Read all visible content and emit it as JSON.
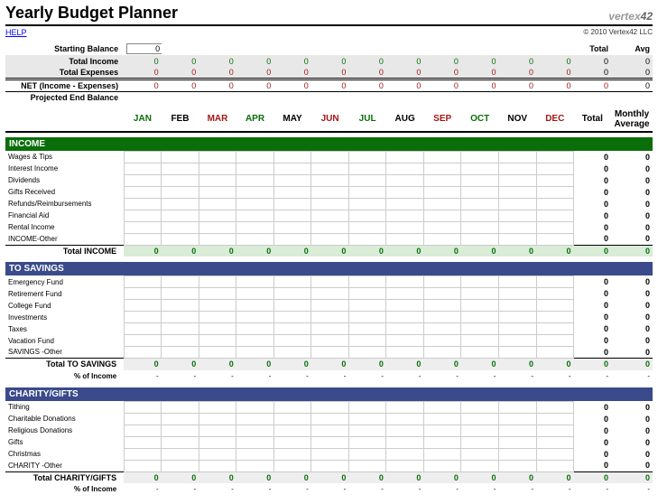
{
  "title": "Yearly Budget Planner",
  "logo_prefix": "vertex",
  "logo_suffix": "42",
  "help": "HELP",
  "copyright": "© 2010 Vertex42 LLC",
  "months": [
    "JAN",
    "FEB",
    "MAR",
    "APR",
    "MAY",
    "JUN",
    "JUL",
    "AUG",
    "SEP",
    "OCT",
    "NOV",
    "DEC"
  ],
  "month_colors": [
    "m-green",
    "m-black",
    "m-red",
    "m-green",
    "m-black",
    "m-red",
    "m-green",
    "m-black",
    "m-red",
    "m-green",
    "m-black",
    "m-red"
  ],
  "summaryHeaders": {
    "total": "Total",
    "avg": "Avg",
    "monthlyAvg": "Monthly\nAverage"
  },
  "summary": {
    "starting": {
      "label": "Starting Balance",
      "value": "0"
    },
    "income": {
      "label": "Total Income",
      "vals": [
        0,
        0,
        0,
        0,
        0,
        0,
        0,
        0,
        0,
        0,
        0,
        0
      ],
      "total": 0,
      "avg": 0
    },
    "expenses": {
      "label": "Total Expenses",
      "vals": [
        0,
        0,
        0,
        0,
        0,
        0,
        0,
        0,
        0,
        0,
        0,
        0
      ],
      "total": 0,
      "avg": 0
    },
    "net": {
      "label": "NET (Income - Expenses)",
      "vals": [
        0,
        0,
        0,
        0,
        0,
        0,
        0,
        0,
        0,
        0,
        0,
        0
      ],
      "total": 0,
      "avg": 0
    },
    "projected": {
      "label": "Projected End Balance"
    }
  },
  "sections": [
    {
      "name": "INCOME",
      "color": "sec-green",
      "rows": [
        "Wages & Tips",
        "Interest Income",
        "Dividends",
        "Gifts Received",
        "Refunds/Reimbursements",
        "Financial Aid",
        "Rental Income",
        "INCOME-Other"
      ],
      "subtotalLabel": "Total INCOME",
      "subtotalClass": "lightgreen",
      "subtotal": {
        "vals": [
          0,
          0,
          0,
          0,
          0,
          0,
          0,
          0,
          0,
          0,
          0,
          0
        ],
        "total": 0,
        "avg": 0
      },
      "pct": null
    },
    {
      "name": "TO SAVINGS",
      "color": "sec-blue",
      "rows": [
        "Emergency Fund",
        "Retirement Fund",
        "College Fund",
        "Investments",
        "Taxes",
        "Vacation Fund",
        "SAVINGS -Other"
      ],
      "subtotalLabel": "Total TO SAVINGS",
      "subtotalClass": "lightgray",
      "subtotal": {
        "vals": [
          0,
          0,
          0,
          0,
          0,
          0,
          0,
          0,
          0,
          0,
          0,
          0
        ],
        "total": 0,
        "avg": 0
      },
      "pct": {
        "label": "% of Income",
        "vals": [
          "-",
          "-",
          "-",
          "-",
          "-",
          "-",
          "-",
          "-",
          "-",
          "-",
          "-",
          "-"
        ],
        "total": "-",
        "avg": "-"
      }
    },
    {
      "name": "CHARITY/GIFTS",
      "color": "sec-blue",
      "rows": [
        "Tithing",
        "Charitable Donations",
        "Religious Donations",
        "Gifts",
        "Christmas",
        "CHARITY -Other"
      ],
      "subtotalLabel": "Total CHARITY/GIFTS",
      "subtotalClass": "lightgray",
      "subtotal": {
        "vals": [
          0,
          0,
          0,
          0,
          0,
          0,
          0,
          0,
          0,
          0,
          0,
          0
        ],
        "total": 0,
        "avg": 0
      },
      "pct": {
        "label": "% of Income",
        "vals": [
          "-",
          "-",
          "-",
          "-",
          "-",
          "-",
          "-",
          "-",
          "-",
          "-",
          "-",
          "-"
        ],
        "total": "-",
        "avg": "-"
      }
    }
  ]
}
